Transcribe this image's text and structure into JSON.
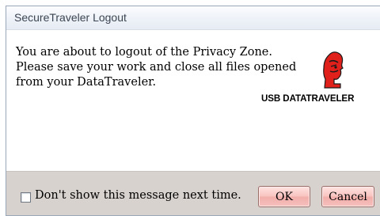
{
  "window": {
    "title": "SecureTraveler Logout"
  },
  "message": {
    "lines": [
      "You are about to logout of the Privacy Zone.",
      "Please save your work and close all files opened",
      "from your DataTraveler."
    ]
  },
  "logo": {
    "text": "USB DATATRAVELER",
    "icon": "kingston-head-logo",
    "color": "#e0201a"
  },
  "footer": {
    "checkbox_label": "Don't show this message next time.",
    "checkbox_checked": false,
    "ok_label": "OK",
    "cancel_label": "Cancel"
  },
  "colors": {
    "footer_bg": "#d7d2ce",
    "button_bg": "#f8c4c0"
  }
}
